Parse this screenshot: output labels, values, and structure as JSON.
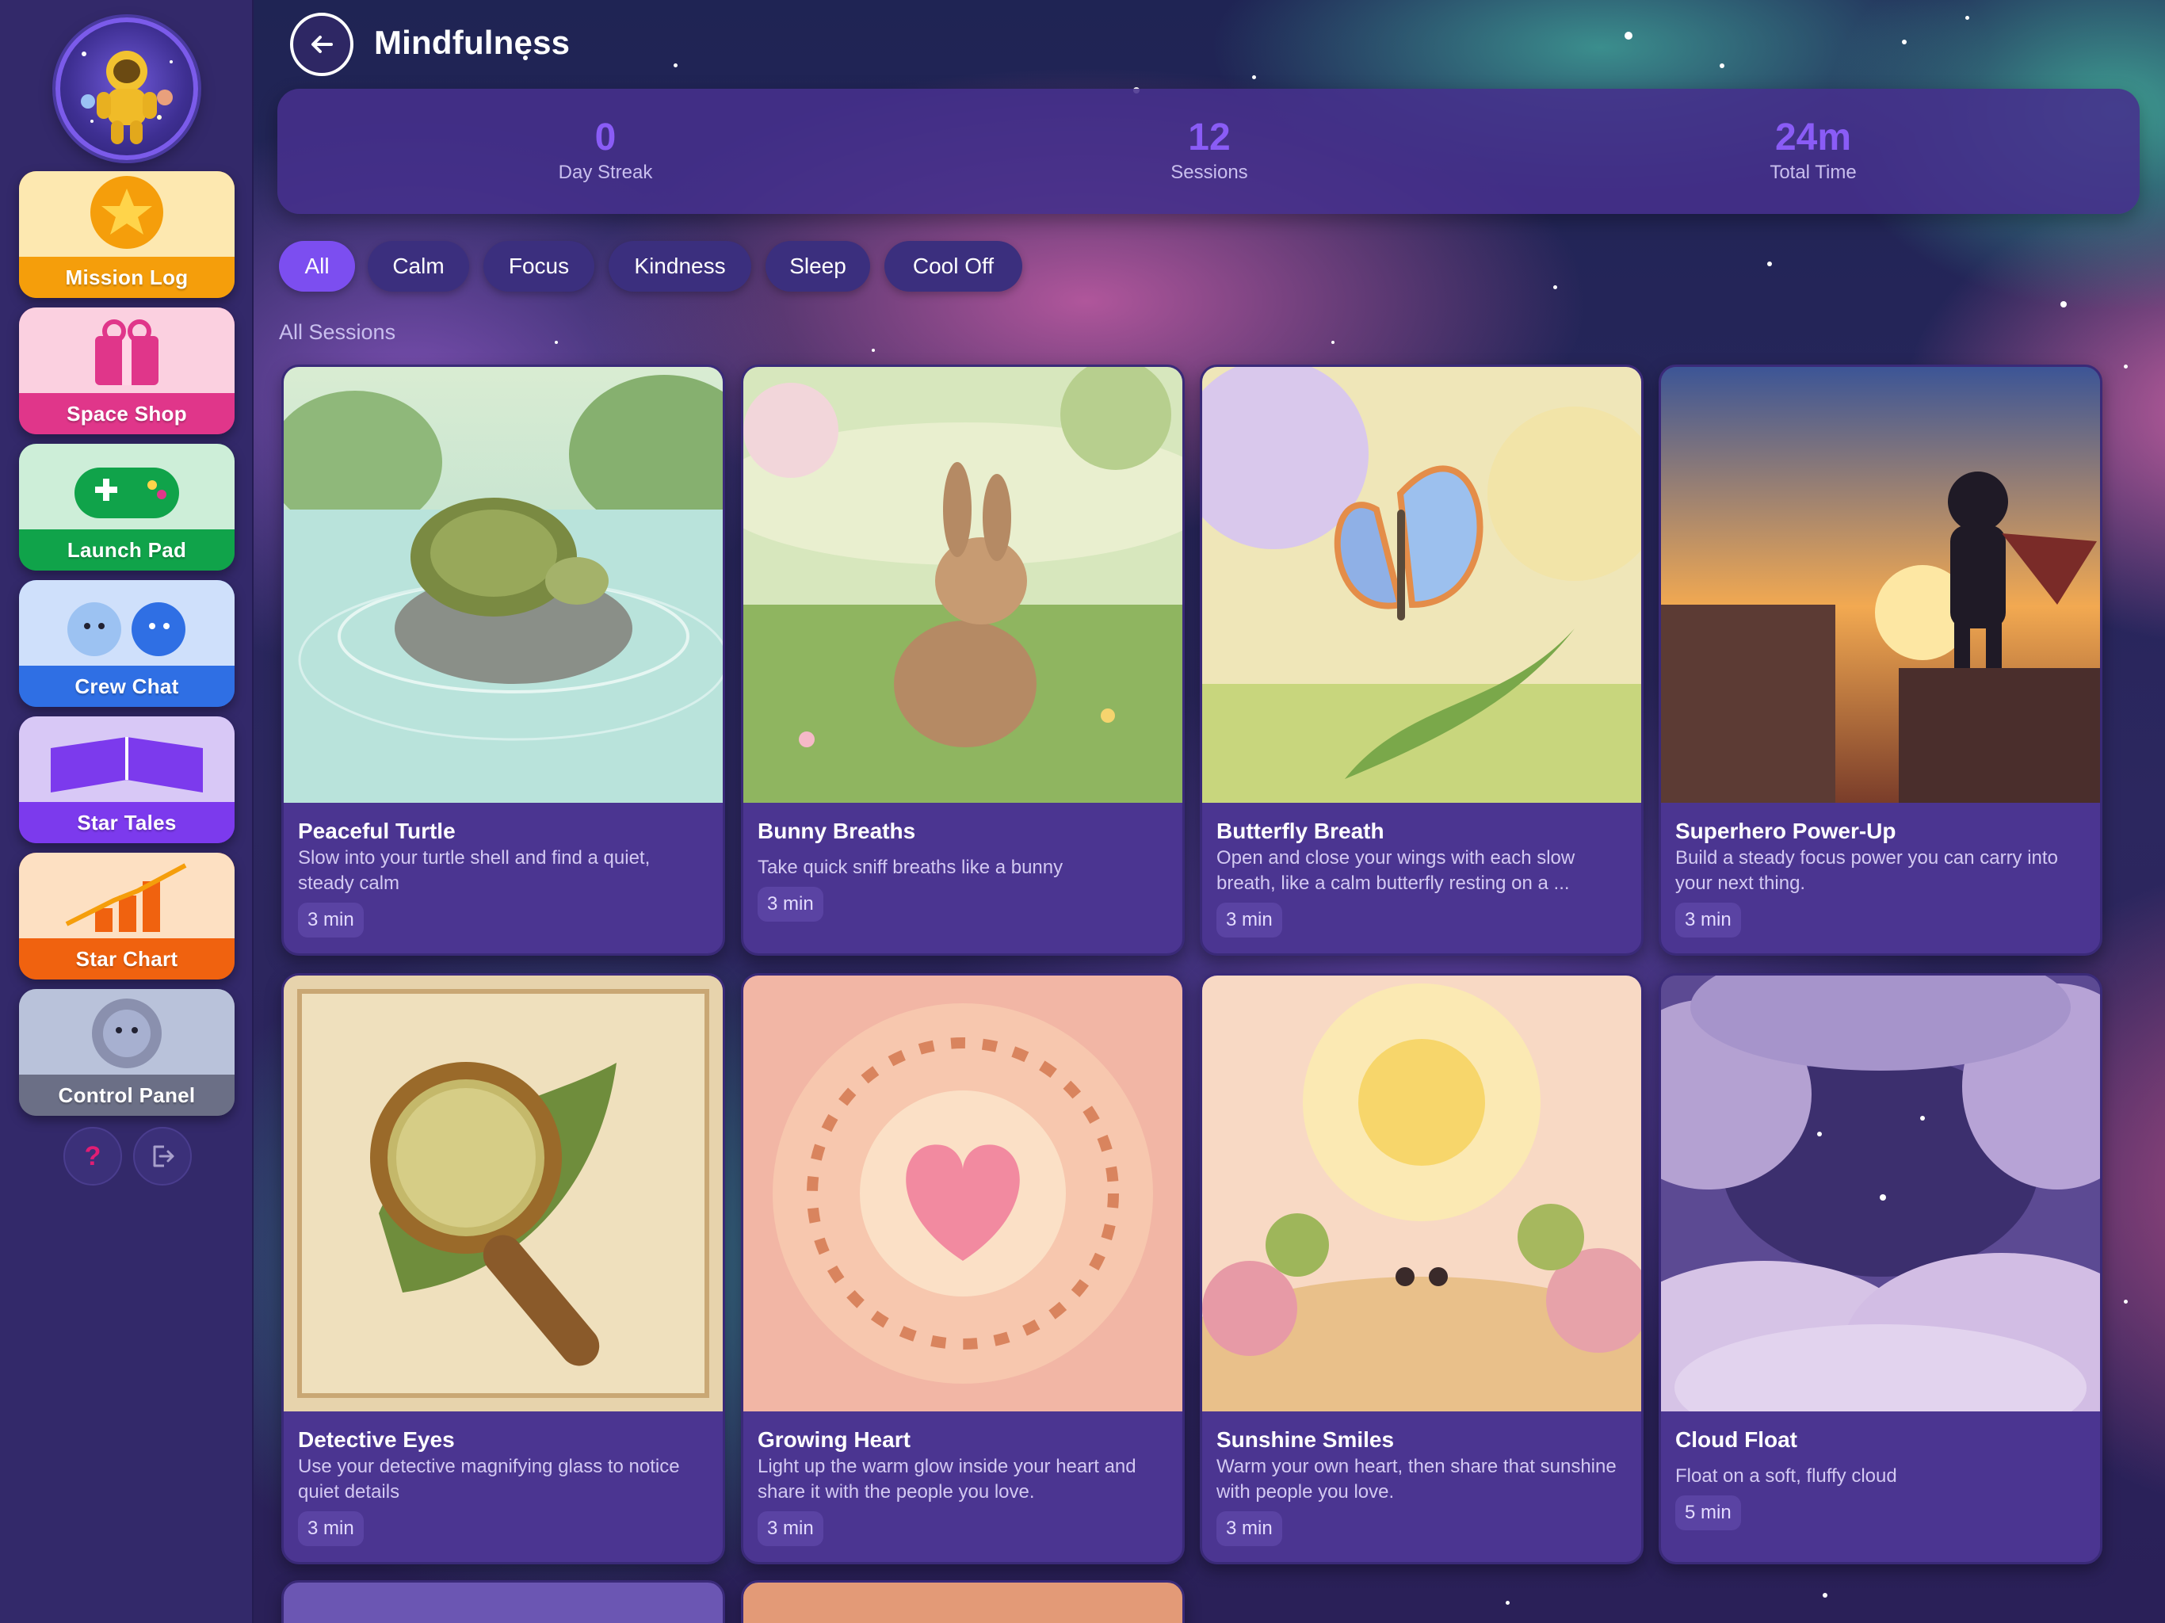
{
  "header": {
    "title": "Mindfulness"
  },
  "stats": [
    {
      "value": "0",
      "label": "Day Streak"
    },
    {
      "value": "12",
      "label": "Sessions"
    },
    {
      "value": "24m",
      "label": "Total Time"
    }
  ],
  "filters": [
    "All",
    "Calm",
    "Focus",
    "Kindness",
    "Sleep",
    "Cool Off"
  ],
  "active_filter": "All",
  "section_label": "All Sessions",
  "sidebar": {
    "items": [
      {
        "label": "Mission Log",
        "color": "#f59e0b"
      },
      {
        "label": "Space Shop",
        "color": "#e0368a"
      },
      {
        "label": "Launch Pad",
        "color": "#10a34a"
      },
      {
        "label": "Crew Chat",
        "color": "#2f6fe4"
      },
      {
        "label": "Star Tales",
        "color": "#7c3aed"
      },
      {
        "label": "Star Chart",
        "color": "#f0620f"
      },
      {
        "label": "Control Panel",
        "color": "#6b6f86"
      }
    ],
    "footer": {
      "help_icon": "help-icon",
      "logout_icon": "logout-icon"
    }
  },
  "sessions": [
    {
      "title": "Peaceful Turtle",
      "description": "Slow into your turtle shell and find a quiet, steady calm",
      "duration": "3 min"
    },
    {
      "title": "Bunny Breaths",
      "description": "Take quick sniff breaths like a bunny",
      "duration": "3 min"
    },
    {
      "title": "Butterfly Breath",
      "description": "Open and close your wings with each slow breath, like a calm butterfly resting on a ...",
      "duration": "3 min"
    },
    {
      "title": "Superhero Power-Up",
      "description": "Build a steady focus power you can carry into your next thing.",
      "duration": "3 min"
    },
    {
      "title": "Detective Eyes",
      "description": "Use your detective magnifying glass to notice quiet details",
      "duration": "3 min"
    },
    {
      "title": "Growing Heart",
      "description": "Light up the warm glow inside your heart and share it with the people you love.",
      "duration": "3 min"
    },
    {
      "title": "Sunshine Smiles",
      "description": "Warm your own heart, then share that sunshine with people you love.",
      "duration": "3 min"
    },
    {
      "title": "Cloud Float",
      "description": "Float on a soft, fluffy cloud",
      "duration": "5 min"
    }
  ],
  "colors": {
    "accent": "#7c4ef0",
    "stat_value": "#8a5cf6",
    "card_bg": "#4b3591"
  }
}
